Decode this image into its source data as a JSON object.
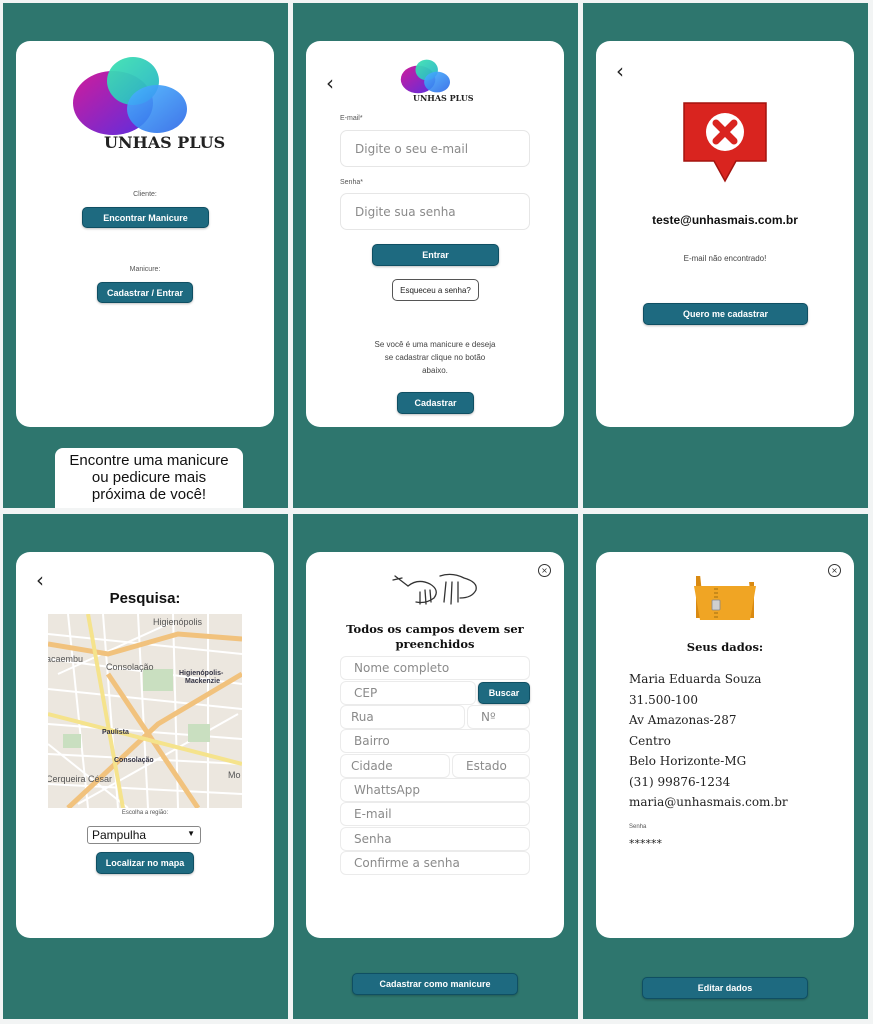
{
  "screen1": {
    "brand": "UNHAS PLUS",
    "client_label": "Cliente:",
    "client_button": "Encontrar Manicure",
    "manicure_label": "Manicure:",
    "manicure_button": "Cadastrar / Entrar",
    "tagline_1": "Encontre uma manicure",
    "tagline_2": "ou pedicure mais",
    "tagline_3": "próxima de você!"
  },
  "screen2": {
    "brand": "UNHAS PLUS",
    "email_label": "E-mail*",
    "email_placeholder": "Digite o seu e-mail",
    "password_label": "Senha*",
    "password_placeholder": "Digite sua senha",
    "login_button": "Entrar",
    "forgot_button": "Esqueceu a senha?",
    "info_1": "Se você é uma manicure e deseja",
    "info_2": "se cadastrar clique no botão",
    "info_3": "abaixo.",
    "register_button": "Cadastrar"
  },
  "screen3": {
    "email": "teste@unhasmais.com.br",
    "message": "E-mail não encontrado!",
    "register_button": "Quero me cadastrar"
  },
  "screen4": {
    "title": "Pesquisa:",
    "map_labels": [
      "Higienópolis",
      "acaembu",
      "Consolação",
      "Higienópolis-",
      "Mackenzie",
      "Paulista",
      "Consolação",
      "Cerqueira César",
      "Mo"
    ],
    "region_label": "Escolha a região:",
    "region_selected": "Pampulha",
    "locate_button": "Localizar no mapa"
  },
  "screen5": {
    "title_1": "Todos os campos devem ser",
    "title_2": "preenchidos",
    "placeholders": {
      "name": "Nome completo",
      "cep": "CEP",
      "street": "Rua",
      "number": "Nº",
      "district": "Bairro",
      "city": "Cidade",
      "state": "Estado",
      "whatsapp": "WhattsApp",
      "email": "E-mail",
      "password": "Senha",
      "confirm": "Confirme a senha"
    },
    "search_button": "Buscar",
    "submit_button": "Cadastrar como manicure"
  },
  "screen6": {
    "title": "Seus dados:",
    "lines": [
      "Maria Eduarda Souza",
      "31.500-100",
      "Av Amazonas-287",
      "Centro",
      "Belo Horizonte-MG",
      "(31) 99876-1234",
      "maria@unhasmais.com.br"
    ],
    "password_label": "Senha",
    "password_value": "******",
    "edit_button": "Editar dados"
  },
  "colors": {
    "panel": "#2e766e",
    "button": "#1e6a80",
    "error_red": "#d9241f",
    "folder": "#f0a524"
  },
  "icons": [
    "unhas-plus-logo",
    "chevron-left-icon",
    "error-marker-icon",
    "map-image",
    "hands-drawing-icon",
    "close-circle-icon",
    "folder-zip-icon",
    "dropdown-arrow-icon"
  ]
}
